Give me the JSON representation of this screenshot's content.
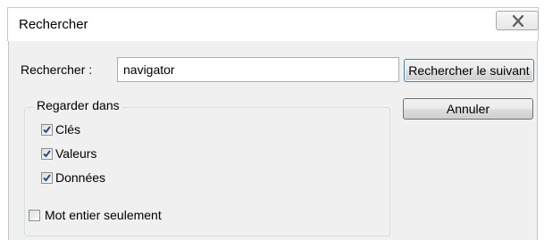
{
  "window": {
    "title": "Rechercher"
  },
  "search": {
    "label": "Rechercher :",
    "value": "navigator"
  },
  "buttons": {
    "find_next": "Rechercher le suivant",
    "cancel": "Annuler"
  },
  "look_in": {
    "legend": "Regarder dans",
    "options": [
      {
        "label": "Clés",
        "checked": true
      },
      {
        "label": "Valeurs",
        "checked": true
      },
      {
        "label": "Données",
        "checked": true
      }
    ]
  },
  "whole_word": {
    "label": "Mot entier seulement",
    "checked": false
  },
  "icons": {
    "close": "close-icon",
    "check": "checkmark-icon"
  },
  "colors": {
    "client_bg": "#f0f0f0",
    "check_blue": "#1f4e8c",
    "default_button_border": "#3c7fb1"
  }
}
